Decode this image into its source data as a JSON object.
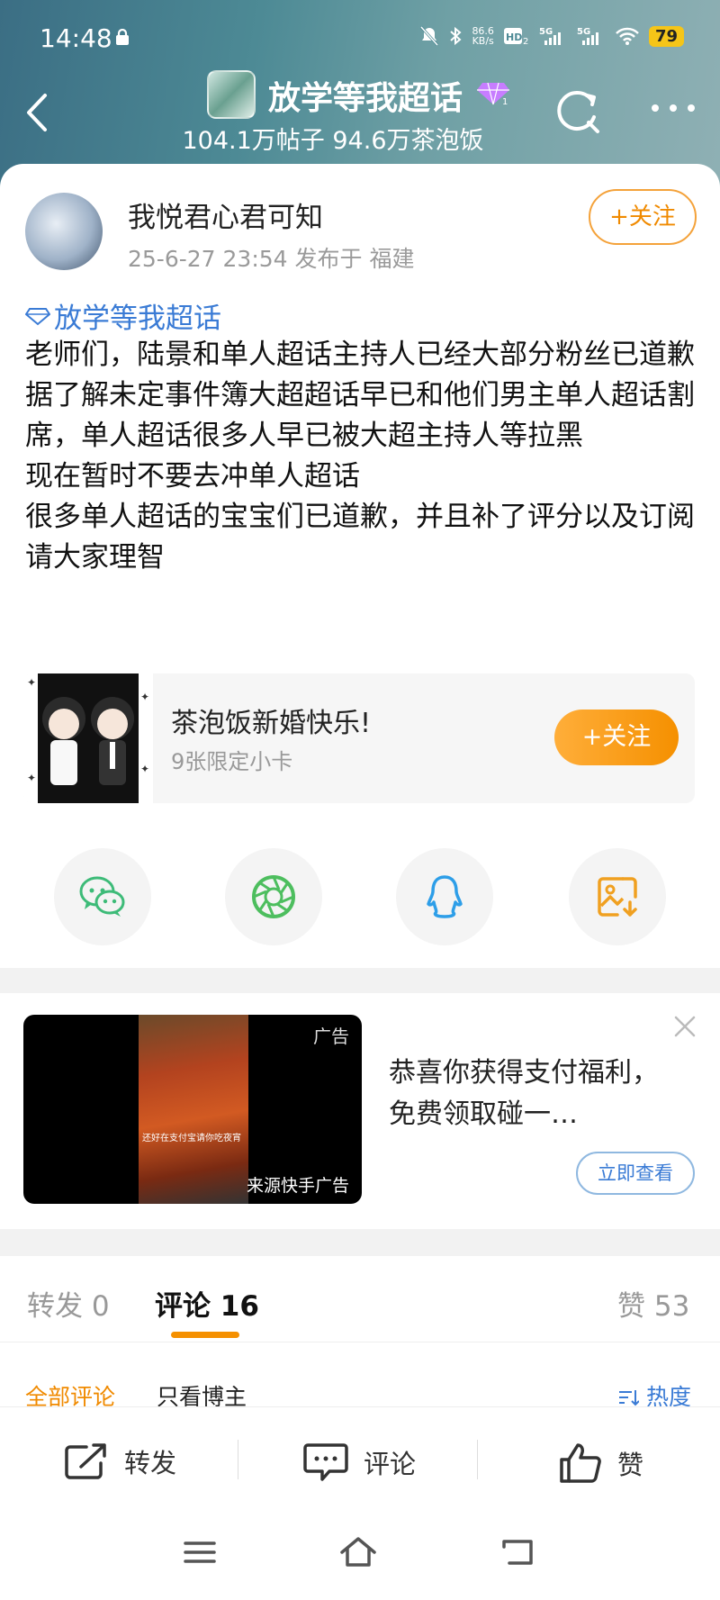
{
  "status_bar": {
    "time": "14:48",
    "net_speed": "86.6\nKB/s",
    "battery": "79"
  },
  "nav": {
    "title": "放学等我超话",
    "subtitle": "104.1万帖子 94.6万茶泡饭"
  },
  "post": {
    "author": "我悦君心君可知",
    "meta": "25-6-27 23:54  发布于 福建",
    "follow_label": "+关注",
    "topic": "放学等我超话",
    "lines": [
      "老师们，陆景和单人超话主持人已经大部分粉丝已道歉",
      "据了解未定事件簿大超超话早已和他们男主单人超话割席，单人超话很多人早已被大超主持人等拉黑",
      "现在暂时不要去冲单人超话",
      "很多单人超话的宝宝们已道歉，并且补了评分以及订阅",
      "请大家理智"
    ]
  },
  "promo": {
    "title": "茶泡饭新婚快乐!",
    "subtitle": "9张限定小卡",
    "button": "+关注"
  },
  "share": {
    "items": [
      "wechat-icon",
      "moments-icon",
      "qq-icon",
      "save-image-icon"
    ]
  },
  "ad": {
    "tag": "广告",
    "source": "来源快手广告",
    "caption": "还好在支付宝请你吃夜宵",
    "text": "恭喜你获得支付福利，免费领取碰一…",
    "button": "立即查看"
  },
  "tabs": {
    "repost": "转发 0",
    "comments": "评论 16",
    "likes": "赞 53"
  },
  "filters": {
    "all": "全部评论",
    "owner_only": "只看博主",
    "hot": "热度"
  },
  "actions": {
    "repost": "转发",
    "comment": "评论",
    "like": "赞"
  },
  "colors": {
    "accent": "#f59000",
    "link": "#3a7bd5"
  }
}
